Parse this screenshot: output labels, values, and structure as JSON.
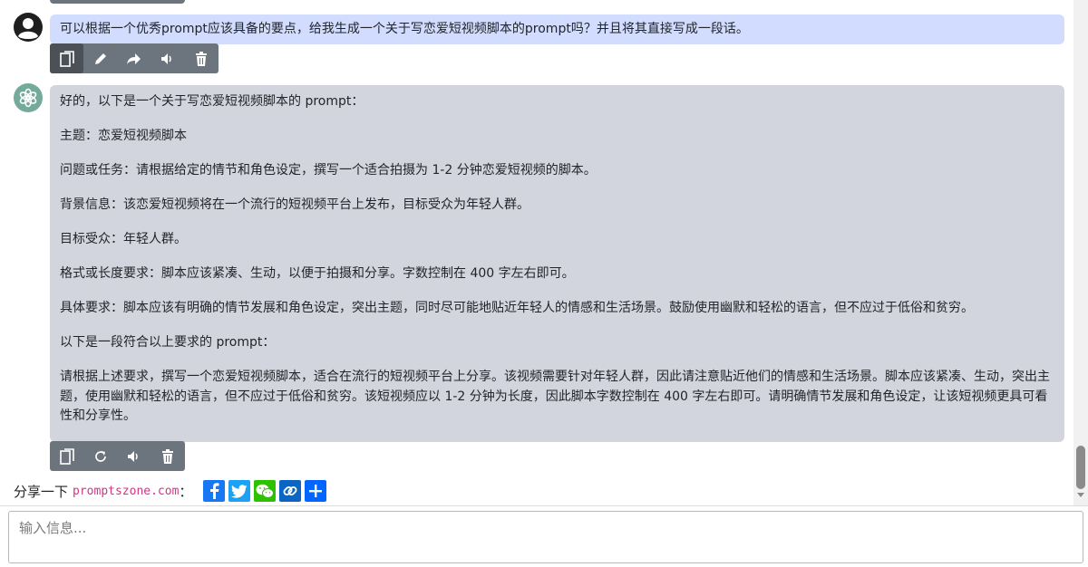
{
  "conversation": {
    "user_message": "可以根据一个优秀prompt应该具备的要点，给我生成一个关于写恋爱短视频脚本的prompt吗？并且将其直接写成一段话。",
    "assistant_paragraphs": [
      "好的，以下是一个关于写恋爱短视频脚本的 prompt：",
      "主题：恋爱短视频脚本",
      "问题或任务：请根据给定的情节和角色设定，撰写一个适合拍摄为 1-2 分钟恋爱短视频的脚本。",
      "背景信息：该恋爱短视频将在一个流行的短视频平台上发布，目标受众为年轻人群。",
      "目标受众：年轻人群。",
      "格式或长度要求：脚本应该紧凑、生动，以便于拍摄和分享。字数控制在 400 字左右即可。",
      "具体要求：脚本应该有明确的情节发展和角色设定，突出主题，同时尽可能地贴近年轻人的情感和生活场景。鼓励使用幽默和轻松的语言，但不应过于低俗和贫穷。",
      "以下是一段符合以上要求的 prompt：",
      "请根据上述要求，撰写一个恋爱短视频脚本，适合在流行的短视频平台上分享。该视频需要针对年轻人群，因此请注意贴近他们的情感和生活场景。脚本应该紧凑、生动，突出主题，使用幽默和轻松的语言，但不应过于低俗和贫穷。该短视频应以 1-2 分钟为长度，因此脚本字数控制在 400 字左右即可。请明确情节发展和角色设定，让该短视频更具可看性和分享性。"
    ]
  },
  "user_toolbar_icons": [
    "copy-icon",
    "edit-icon",
    "share-icon",
    "speaker-icon",
    "trash-icon"
  ],
  "assistant_toolbar_icons": [
    "copy-icon",
    "regenerate-icon",
    "speaker-icon",
    "trash-icon"
  ],
  "share": {
    "label": "分享一下",
    "domain": "promptszone.com",
    "colon": "：",
    "buttons": [
      {
        "name": "facebook",
        "color": "#1877f2"
      },
      {
        "name": "twitter",
        "color": "#1da1f2"
      },
      {
        "name": "wechat",
        "color": "#2dc100"
      },
      {
        "name": "copy-link",
        "color": "#0a66c2"
      },
      {
        "name": "more",
        "color": "#0166ff"
      }
    ]
  },
  "input": {
    "placeholder": "输入信息..."
  },
  "colors": {
    "user_bubble": "#d1dcff",
    "assistant_bubble": "#d2d5dd",
    "toolbar": "#6c757d",
    "domain_text": "#d63384"
  }
}
